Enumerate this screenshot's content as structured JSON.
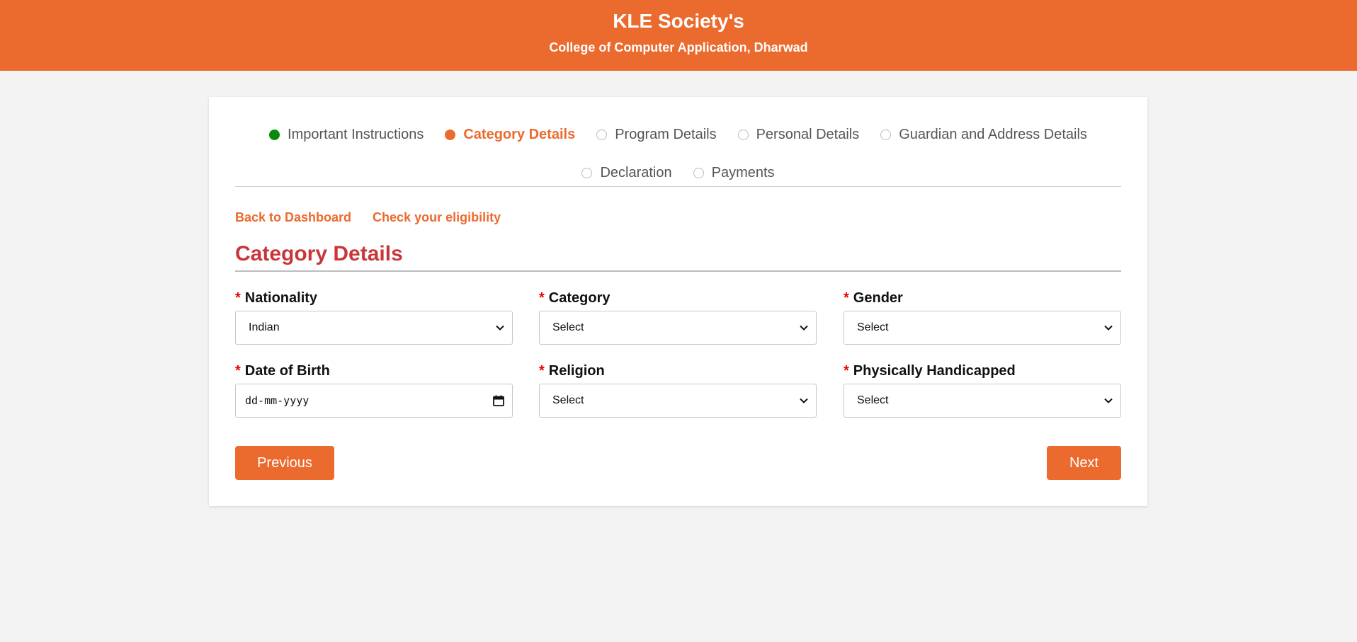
{
  "header": {
    "title": "KLE Society's",
    "subtitle": "College of Computer Application, Dharwad"
  },
  "steps": [
    {
      "label": "Important Instructions",
      "state": "done"
    },
    {
      "label": "Category Details",
      "state": "active"
    },
    {
      "label": "Program Details",
      "state": "pending"
    },
    {
      "label": "Personal Details",
      "state": "pending"
    },
    {
      "label": "Guardian and Address Details",
      "state": "pending"
    },
    {
      "label": "Declaration",
      "state": "pending"
    },
    {
      "label": "Payments",
      "state": "pending"
    }
  ],
  "links": {
    "back": "Back to Dashboard",
    "eligibility": "Check your eligibility"
  },
  "section": {
    "title": "Category Details"
  },
  "form": {
    "required_mark": "*",
    "nationality": {
      "label": "Nationality",
      "value": "Indian"
    },
    "category": {
      "label": "Category",
      "value": "Select"
    },
    "gender": {
      "label": "Gender",
      "value": "Select"
    },
    "dob": {
      "label": "Date of Birth",
      "placeholder": "dd-mm-yyyy"
    },
    "religion": {
      "label": "Religion",
      "value": "Select"
    },
    "handicapped": {
      "label": "Physically Handicapped",
      "value": "Select"
    }
  },
  "buttons": {
    "previous": "Previous",
    "next": "Next"
  },
  "colors": {
    "accent": "#eb6a2e",
    "done": "#0a8a0a",
    "section_title": "#c9363a",
    "required": "#e00000"
  },
  "icons": [
    "step-done-icon",
    "step-active-icon",
    "step-pending-icon",
    "chevron-down-icon",
    "calendar-icon"
  ]
}
